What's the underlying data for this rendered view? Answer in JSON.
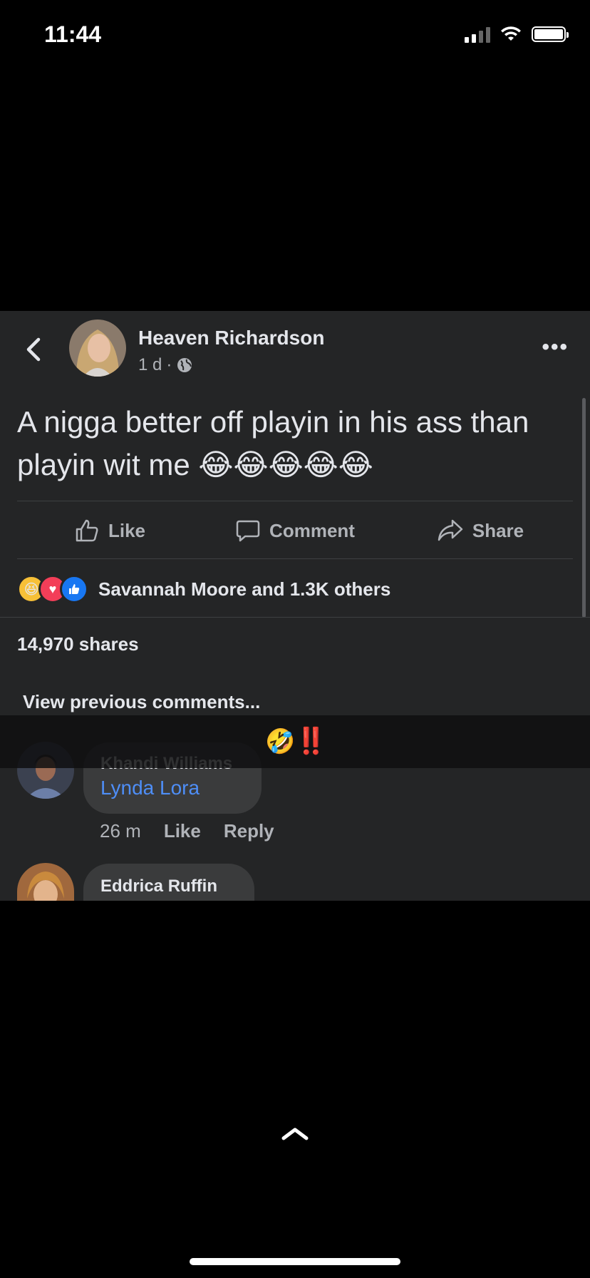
{
  "status_bar": {
    "time": "11:44",
    "battery_level": 1.0
  },
  "post": {
    "author": "Heaven Richardson",
    "time_ago": "1 d",
    "separator": "·",
    "privacy_icon": "globe-icon",
    "text": "A nigga better off playin in his ass than playin wit me 😂😂😂😂😂",
    "actions": {
      "like": "Like",
      "comment": "Comment",
      "share": "Share"
    },
    "reaction_icons": [
      "haha-icon",
      "love-icon",
      "like-icon"
    ],
    "reaction_summary": "Savannah Moore and 1.3K others",
    "shares": "14,970 shares"
  },
  "comments": {
    "view_previous": "View previous comments...",
    "overlay_emoji": "🤣",
    "overlay_mark": "‼️",
    "items": [
      {
        "name": "Khandi Williams",
        "mention": "Lynda Lora",
        "time": "26 m",
        "like": "Like",
        "reply": "Reply"
      },
      {
        "name": "Eddrica Ruffin"
      }
    ]
  },
  "colors": {
    "card_bg": "#242526",
    "text": "#e4e6eb",
    "muted": "#b0b3b8",
    "mention": "#4e8ef7"
  }
}
